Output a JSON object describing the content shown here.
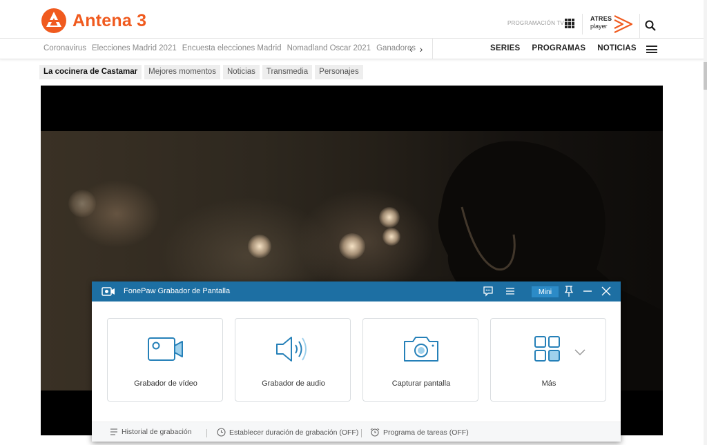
{
  "site": {
    "logo_text": "Antena 3",
    "programacion_label": "PROGRAMACIÓN TV",
    "atres_line1": "ATRES",
    "atres_line2": "player",
    "brand_color": "#f05a1e"
  },
  "trending": [
    "Coronavirus",
    "Elecciones Madrid 2021",
    "Encuesta elecciones Madrid",
    "Nomadland Oscar 2021",
    "Ganadores"
  ],
  "arrows": {
    "prev": "‹",
    "next": "›"
  },
  "main_nav": [
    "SERIES",
    "PROGRAMAS",
    "NOTICIAS"
  ],
  "subtabs": [
    "La cocinera de Castamar",
    "Mejores momentos",
    "Noticias",
    "Transmedia",
    "Personajes"
  ],
  "recorder": {
    "title": "FonePaw Grabador de Pantalla",
    "mini_label": "Mini",
    "accent_color": "#1d6fa3",
    "cards": [
      {
        "label": "Grabador de vídeo",
        "icon": "video-camera-icon"
      },
      {
        "label": "Grabador de audio",
        "icon": "speaker-icon"
      },
      {
        "label": "Capturar pantalla",
        "icon": "camera-icon"
      },
      {
        "label": "Más",
        "icon": "grid-four-icon"
      }
    ],
    "footer": [
      {
        "label": "Historial de grabación",
        "icon": "list-icon"
      },
      {
        "label": "Establecer duración de grabación (OFF)",
        "icon": "clock-icon"
      },
      {
        "label": "Programa de tareas (OFF)",
        "icon": "alarm-icon"
      }
    ]
  }
}
